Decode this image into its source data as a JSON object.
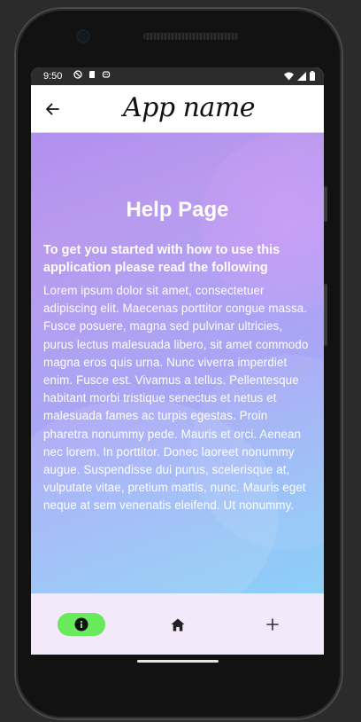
{
  "status_bar": {
    "time": "9:50"
  },
  "app_bar": {
    "title": "App name",
    "back_icon": "arrow-left-icon"
  },
  "content": {
    "title": "Help Page",
    "subtitle": "To get you started with how to use this application please read the following",
    "body": "Lorem ipsum dolor sit amet, consectetuer adipiscing elit. Maecenas porttitor congue massa. Fusce posuere, magna sed pulvinar ultricies, purus lectus malesuada libero, sit amet commodo magna eros quis urna. Nunc viverra imperdiet enim. Fusce est. Vivamus a tellus. Pellentesque habitant morbi tristique senectus et netus et malesuada fames ac turpis egestas. Proin pharetra nonummy pede. Mauris et orci. Aenean nec lorem. In porttitor. Donec laoreet nonummy augue. Suspendisse dui purus, scelerisque at, vulputate vitae, pretium mattis, nunc. Mauris eget neque at sem venenatis eleifend. Ut nonummy."
  },
  "bottom_nav": {
    "items": [
      {
        "icon": "info-icon",
        "active": true
      },
      {
        "icon": "home-icon",
        "active": false
      },
      {
        "icon": "plus-icon",
        "active": false
      }
    ],
    "active_color": "#69ea5d"
  },
  "colors": {
    "gradient_start": "#b08fee",
    "gradient_end": "#8ed0f8",
    "nav_background": "#f3e9fb"
  }
}
